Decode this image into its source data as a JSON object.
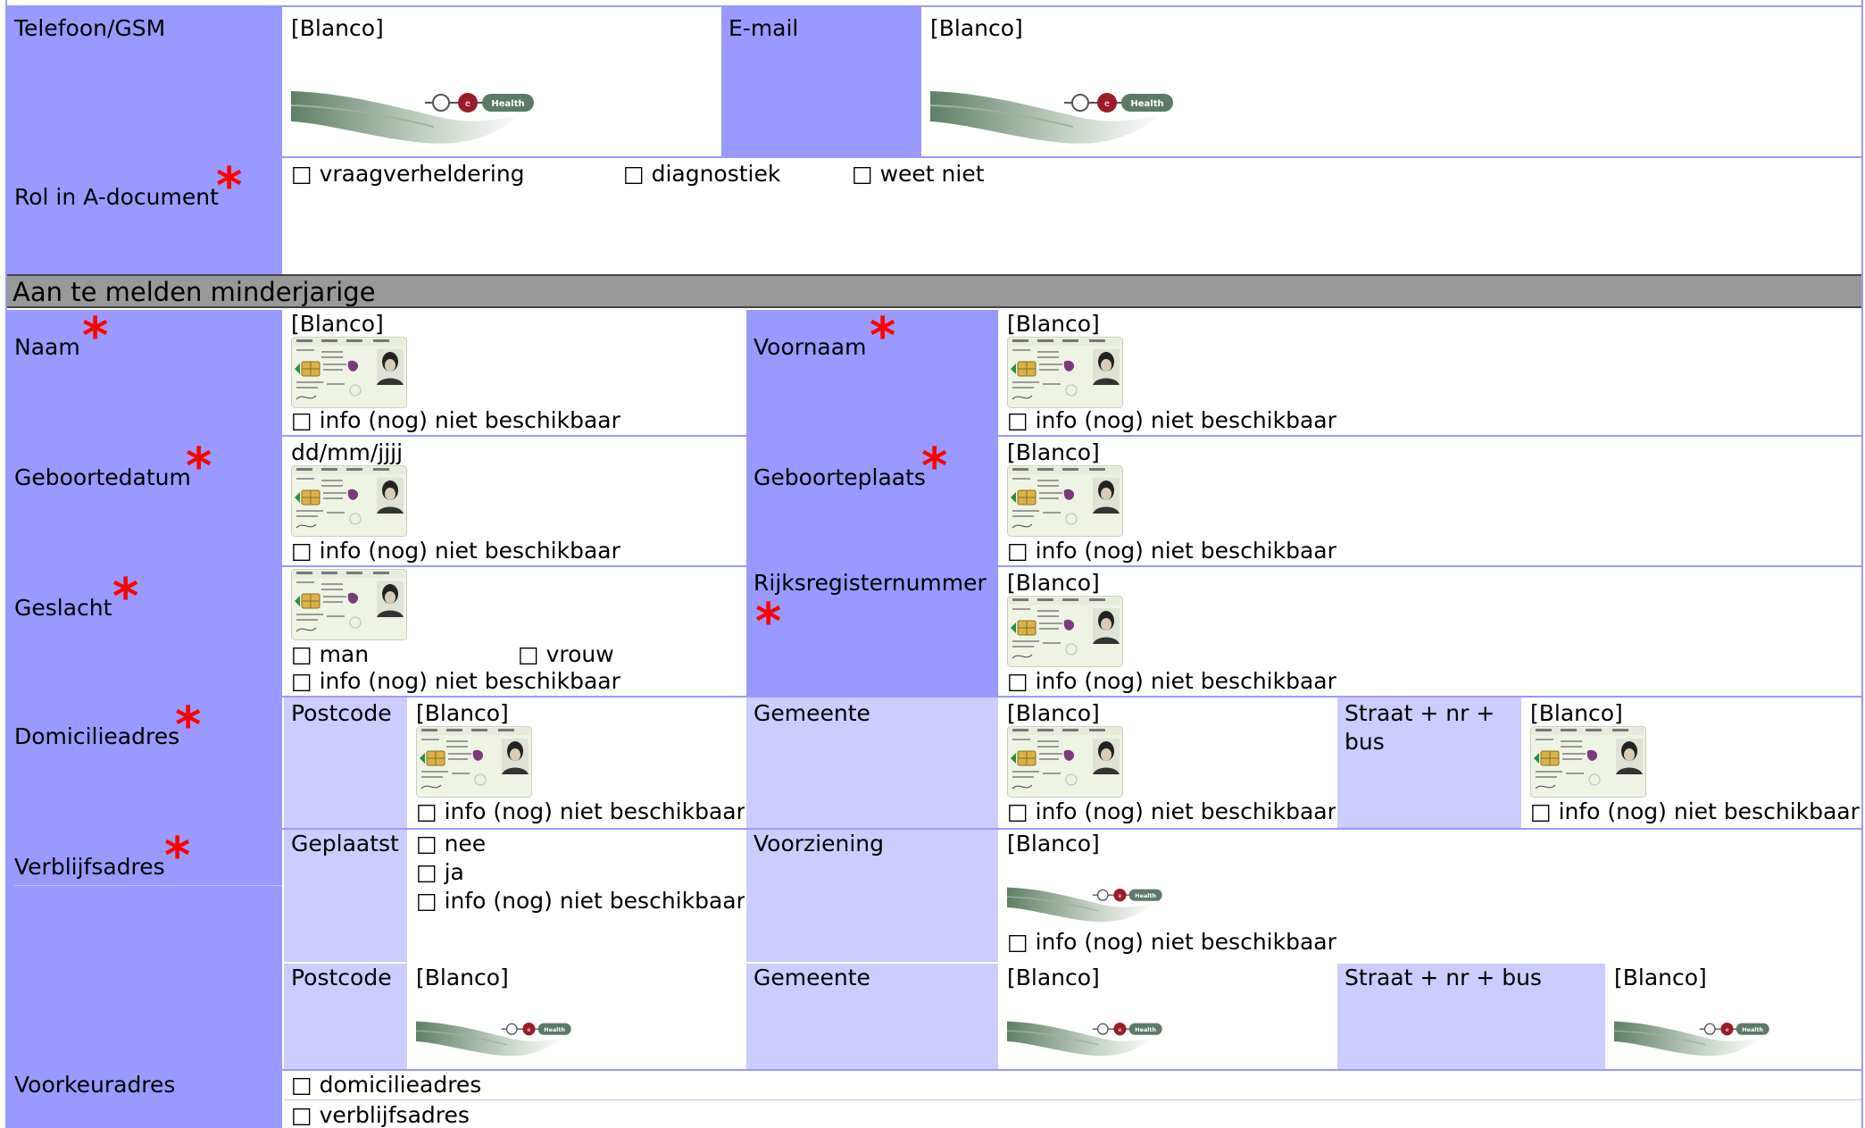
{
  "contact": {
    "phone_label": "Telefoon/GSM",
    "phone_value": "[Blanco]",
    "email_label": "E-mail",
    "email_value": "[Blanco]"
  },
  "role": {
    "label": "Rol in A-document",
    "options": [
      "vraagverheldering",
      "diagnostiek",
      "weet niet"
    ]
  },
  "section_title": "Aan te melden minderjarige",
  "checkbox_glyph": "□",
  "required_mark": "*",
  "fields": {
    "naam": {
      "label": "Naam",
      "value": "[Blanco]"
    },
    "voornaam": {
      "label": "Voornaam",
      "value": "[Blanco]"
    },
    "geboortedatum": {
      "label": "Geboortedatum",
      "value": "dd/mm/jjjj"
    },
    "geboorteplaats": {
      "label": "Geboorteplaats",
      "value": "[Blanco]"
    },
    "geslacht": {
      "label": "Geslacht",
      "options": [
        "man",
        "vrouw"
      ]
    },
    "rijksregisternummer": {
      "label": "Rijksregisternummer",
      "value": "[Blanco]"
    },
    "not_available": "info (nog) niet beschikbaar"
  },
  "domicile": {
    "label": "Domicilieadres",
    "postcode_label": "Postcode",
    "postcode_value": "[Blanco]",
    "gemeente_label": "Gemeente",
    "gemeente_value": "[Blanco]",
    "straat_label": "Straat + nr + bus",
    "straat_value": "[Blanco]"
  },
  "residence": {
    "label": "Verblijfsadres",
    "geplaatst_label": "Geplaatst",
    "geplaatst_options": [
      "nee",
      "ja",
      "info (nog) niet beschikbaar"
    ],
    "voorziening_label": "Voorziening",
    "voorziening_value": "[Blanco]",
    "postcode_label": "Postcode",
    "postcode_value": "[Blanco]",
    "gemeente_label": "Gemeente",
    "gemeente_value": "[Blanco]",
    "straat_label": "Straat + nr + bus",
    "straat_value": "[Blanco]"
  },
  "preference": {
    "label": "Voorkeuradres",
    "options": [
      "domicilieadres",
      "verblijfsadres"
    ]
  },
  "colors": {
    "label_bg": "#9999ff",
    "sublabel_bg": "#ccccff",
    "section_bg": "#999999",
    "required": "#ff0000"
  },
  "icons": {
    "ehealth": "ehealth-logo-icon",
    "eid": "eid-card-icon"
  }
}
